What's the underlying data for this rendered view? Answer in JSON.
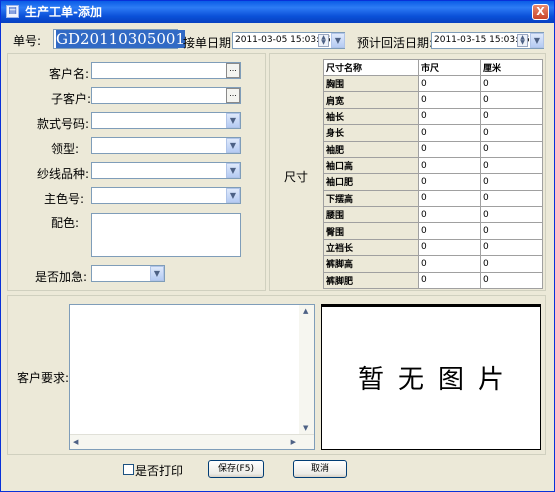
{
  "window": {
    "title": "生产工单-添加",
    "close_glyph": "X"
  },
  "header": {
    "order_no_label": "单号:",
    "order_no_value": "GD20110305001",
    "receive_date_label": "接单日期:",
    "receive_date_value": "2011-03-05 15:03:26",
    "expected_return_label": "预计回活日期:",
    "expected_return_value": "2011-03-15 15:03:26"
  },
  "form": {
    "customer_label": "客户名:",
    "subcustomer_label": "子客户:",
    "style_no_label": "款式号码:",
    "collar_label": "领型:",
    "yarn_label": "纱线品种:",
    "main_color_label": "主色号:",
    "color_match_label": "配色:",
    "urgent_label": "是否加急:",
    "ellipsis": "...",
    "dropdown_glyph": "▼"
  },
  "size": {
    "section_label": "尺寸",
    "columns": [
      "尺寸名称",
      "市尺",
      "厘米"
    ],
    "rows": [
      {
        "name": "胸围",
        "shichi": "0",
        "cm": "0"
      },
      {
        "name": "肩宽",
        "shichi": "0",
        "cm": "0"
      },
      {
        "name": "袖长",
        "shichi": "0",
        "cm": "0"
      },
      {
        "name": "身长",
        "shichi": "0",
        "cm": "0"
      },
      {
        "name": "袖肥",
        "shichi": "0",
        "cm": "0"
      },
      {
        "name": "袖口高",
        "shichi": "0",
        "cm": "0"
      },
      {
        "name": "袖口肥",
        "shichi": "0",
        "cm": "0"
      },
      {
        "name": "下摆高",
        "shichi": "0",
        "cm": "0"
      },
      {
        "name": "腰围",
        "shichi": "0",
        "cm": "0"
      },
      {
        "name": "臀围",
        "shichi": "0",
        "cm": "0"
      },
      {
        "name": "立裆长",
        "shichi": "0",
        "cm": "0"
      },
      {
        "name": "裤脚高",
        "shichi": "0",
        "cm": "0"
      },
      {
        "name": "裤脚肥",
        "shichi": "0",
        "cm": "0"
      }
    ]
  },
  "requirements": {
    "label": "客户要求:"
  },
  "picture": {
    "placeholder": "暂无图片"
  },
  "footer": {
    "print_label": "是否打印",
    "save_label": "保存(F5)",
    "cancel_label": "取消"
  }
}
